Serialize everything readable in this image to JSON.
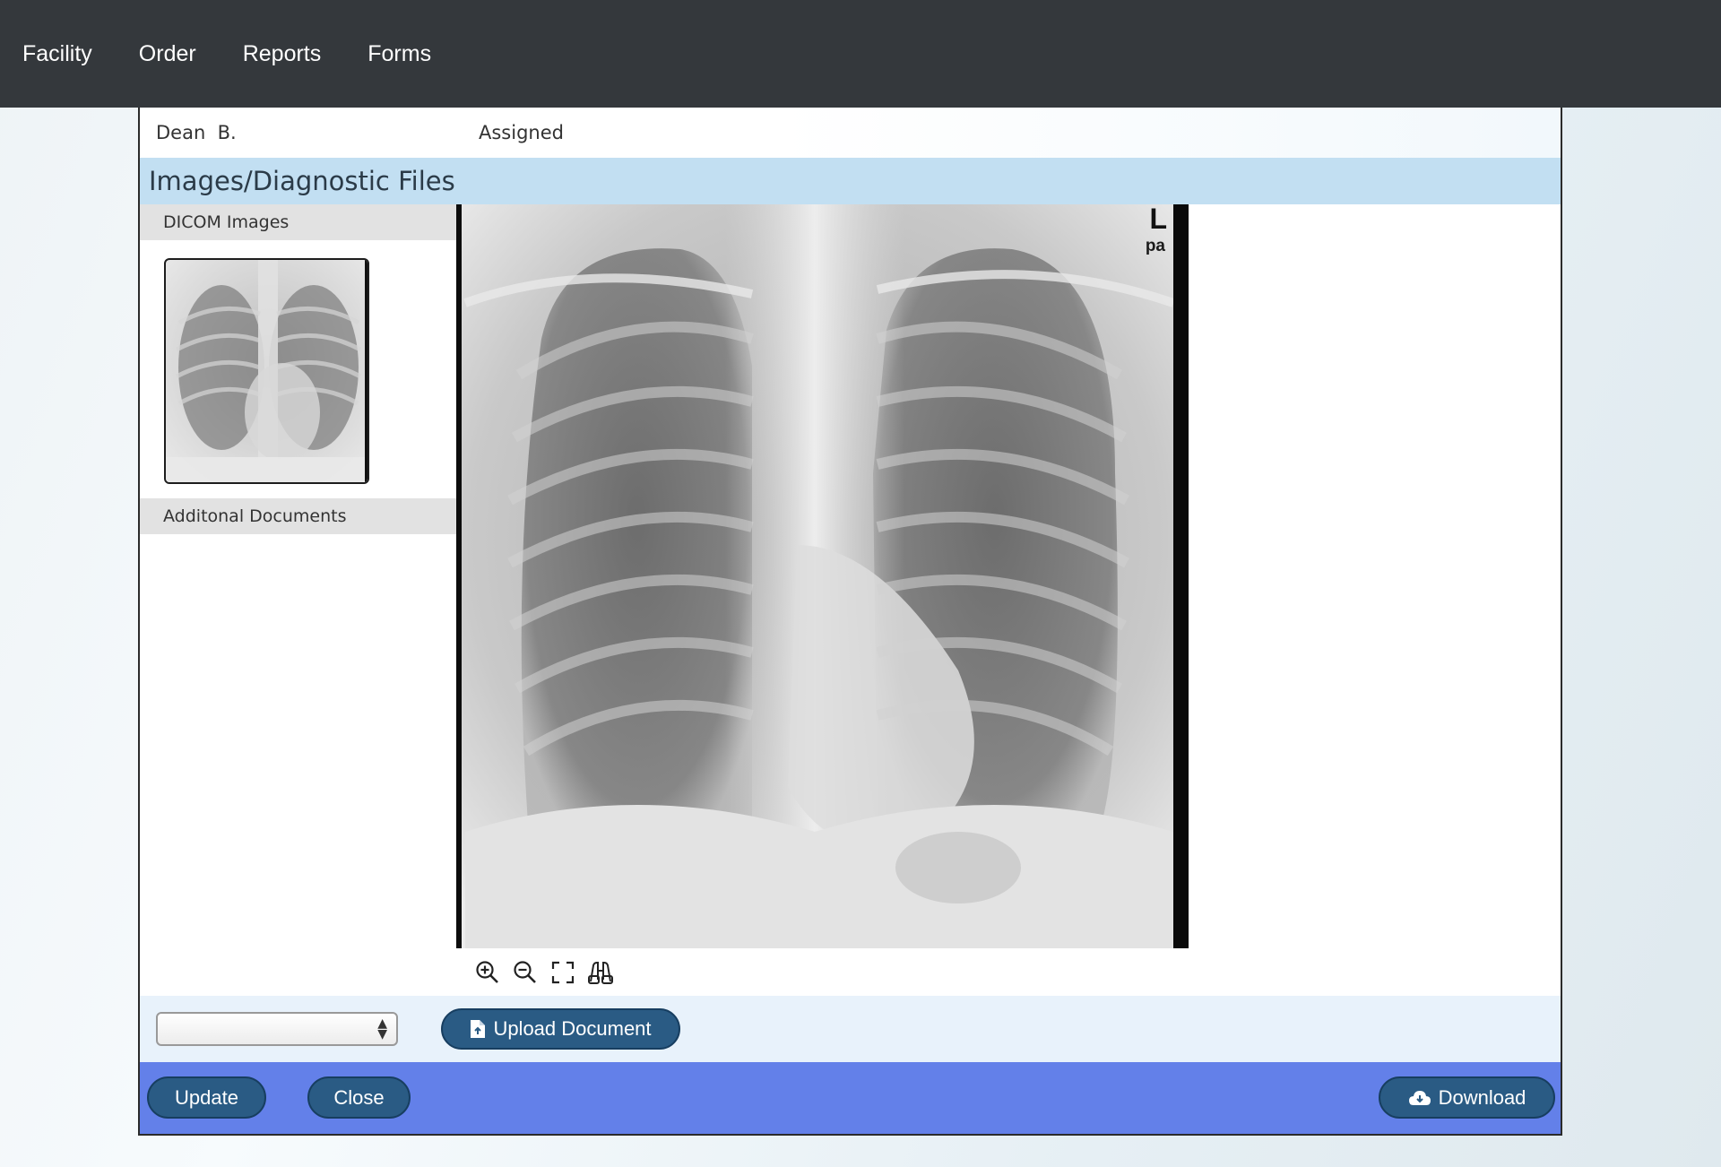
{
  "nav": {
    "items": [
      {
        "label": "Facility"
      },
      {
        "label": "Order"
      },
      {
        "label": "Reports"
      },
      {
        "label": "Forms"
      }
    ]
  },
  "record": {
    "patient_name": "Dean  B.",
    "status": "Assigned"
  },
  "section": {
    "title": "Images/Diagnostic Files"
  },
  "sidebar": {
    "dicom_heading": "DICOM Images",
    "docs_heading": "Additonal Documents"
  },
  "viewer": {
    "marker_side": "L",
    "marker_view": "pa",
    "tools": [
      "zoom-in-icon",
      "zoom-out-icon",
      "fullscreen-icon",
      "binoculars-icon"
    ]
  },
  "upload": {
    "select_value": "",
    "button_label": "Upload Document"
  },
  "footer": {
    "update_label": "Update",
    "close_label": "Close",
    "download_label": "Download"
  },
  "colors": {
    "nav_bg": "#34383c",
    "section_bg": "#c2dff2",
    "footer_bg": "#6380e9",
    "button_bg": "#2a5b84"
  }
}
